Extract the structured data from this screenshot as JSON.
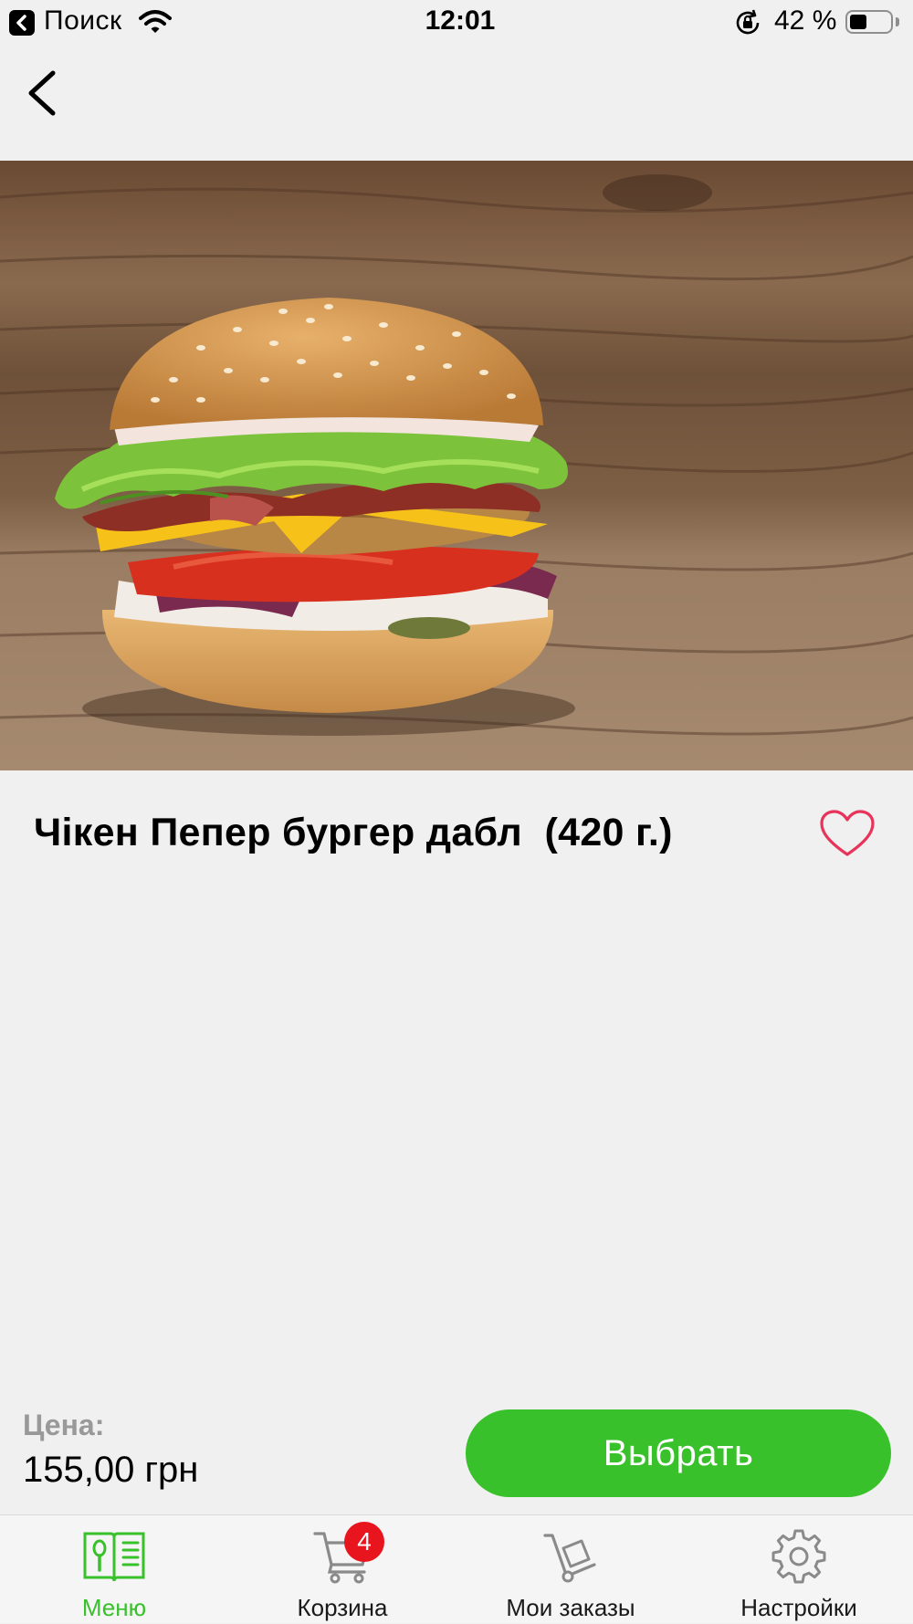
{
  "status_bar": {
    "back_app": "Поиск",
    "time": "12:01",
    "battery_percent": "42 %",
    "battery_level": 0.42
  },
  "product": {
    "title": "Чікен Пепер бургер дабл  (420 г.)",
    "image_icon": "burger-photo",
    "favorite_icon": "heart-icon"
  },
  "price": {
    "label": "Цена:",
    "value": "155,00 грн"
  },
  "actions": {
    "choose_label": "Выбрать"
  },
  "tab_bar": {
    "items": [
      {
        "label": "Меню",
        "icon": "menu-book-icon",
        "active": true
      },
      {
        "label": "Корзина",
        "icon": "cart-icon",
        "active": false,
        "badge": "4"
      },
      {
        "label": "Мои заказы",
        "icon": "hand-truck-icon",
        "active": false
      },
      {
        "label": "Настройки",
        "icon": "gear-icon",
        "active": false
      }
    ]
  },
  "colors": {
    "accent": "#38c12a",
    "background": "#f0f0f0",
    "heart": "#e8345a",
    "badge": "#e8141e",
    "price_label": "#999999"
  }
}
